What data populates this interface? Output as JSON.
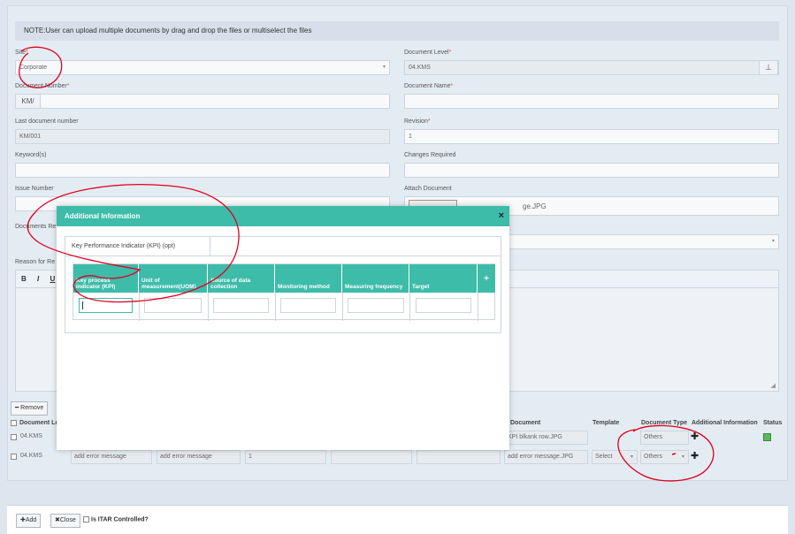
{
  "note": "NOTE:User can upload multiple documents by drag and drop the files or multiselect the files",
  "form": {
    "site_label": "Site",
    "site_value": "Corporate",
    "doc_level_label": "Document Level",
    "doc_level_value": "04.KMS",
    "doc_number_label": "Document Number",
    "doc_number_prefix": "KM/",
    "doc_name_label": "Document Name",
    "last_doc_label": "Last document number",
    "last_doc_value": "KM/001",
    "revision_label": "Revision",
    "revision_value": "1",
    "keywords_label": "Keyword(s)",
    "changes_label": "Changes Required",
    "issue_label": "Issue Number",
    "attach_label": "Attach Document",
    "attach_value": "ge.JPG",
    "docs_req_label": "Documents Re",
    "reason_label": "Reason for Re",
    "required_mark": "*"
  },
  "editor": {
    "bold": "B",
    "italic": "I",
    "underline": "U"
  },
  "remove_button": "Remove",
  "grid": {
    "headers": {
      "doc_level": "Document Le",
      "document": "Document",
      "template": "Template",
      "doc_type": "Document Type",
      "additional": "Additional Information",
      "status": "Status"
    },
    "row1": {
      "level": "04.KMS",
      "file": "KPI blkank row.JPG",
      "type": "Others"
    },
    "row2": {
      "level": "04.KMS",
      "err1": "add error message",
      "err2": "add error message",
      "rev": "1",
      "file": "add error message.JPG",
      "template": "Select",
      "type": "Others"
    }
  },
  "footer": {
    "add": "Add",
    "close": "Close",
    "itar": "Is ITAR Controlled?"
  },
  "modal": {
    "title": "Additional Information",
    "close": "×",
    "tab": "Key Performance Indicator (KPI) (opt)",
    "columns": [
      "Key process indicator (KPI)",
      "Unit of measurement(UOM)",
      "Source of data collection",
      "Monitoring method",
      "Measuring frequency",
      "Target"
    ],
    "add": "+"
  },
  "icons": {
    "hierarchy": "sitemap-icon",
    "close": "close-icon",
    "plus": "plus-icon",
    "minus": "minus-icon"
  },
  "colors": {
    "teal": "#3dbcaa",
    "annotation": "#e0001b"
  }
}
